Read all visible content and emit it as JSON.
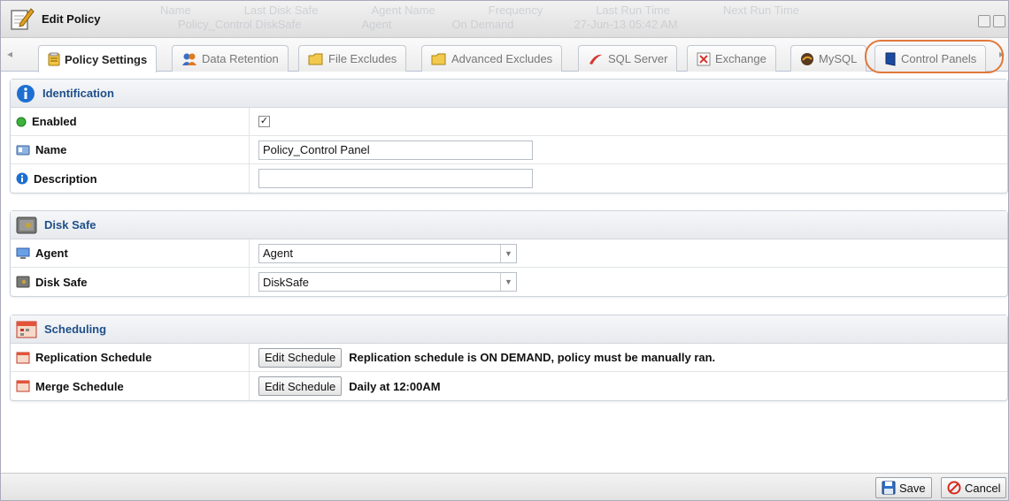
{
  "window": {
    "title": "Edit Policy",
    "bg_rows": [
      [
        "Name",
        "Last Disk Safe",
        "Agent Name",
        "Frequency",
        "Last Run Time",
        "Next Run Time"
      ],
      [
        "Policy_Control DiskSafe",
        "Agent",
        "On Demand",
        "27-Jun-13 05:42 AM"
      ]
    ]
  },
  "tabs": [
    {
      "label": "Policy Settings",
      "icon": "policy-settings-icon",
      "active": true
    },
    {
      "label": "Data Retention",
      "icon": "data-retention-icon"
    },
    {
      "label": "File Excludes",
      "icon": "folder-icon"
    },
    {
      "label": "Advanced Excludes",
      "icon": "folder-icon"
    },
    {
      "label": "SQL Server",
      "icon": "sql-server-icon"
    },
    {
      "label": "Exchange",
      "icon": "exchange-icon"
    },
    {
      "label": "MySQL",
      "icon": "mysql-icon"
    },
    {
      "label": "Control Panels",
      "icon": "control-panels-icon"
    }
  ],
  "identification": {
    "title": "Identification",
    "enabled_label": "Enabled",
    "enabled_checked": true,
    "checkmark": "✓",
    "name_label": "Name",
    "name_value": "Policy_Control Panel",
    "description_label": "Description",
    "description_value": ""
  },
  "disk_safe": {
    "title": "Disk Safe",
    "agent_label": "Agent",
    "agent_value": "Agent",
    "disksafe_label": "Disk Safe",
    "disksafe_value": "DiskSafe"
  },
  "scheduling": {
    "title": "Scheduling",
    "replication_label": "Replication Schedule",
    "replication_button": "Edit Schedule",
    "replication_text": "Replication schedule is ON DEMAND, policy must be manually ran.",
    "merge_label": "Merge Schedule",
    "merge_button": "Edit Schedule",
    "merge_text": "Daily at 12:00AM"
  },
  "footer": {
    "save_label": "Save",
    "cancel_label": "Cancel"
  },
  "colors": {
    "accent": "#1f4f8a",
    "highlight": "#e2773a",
    "enabled_dot": "#3cb33c"
  }
}
